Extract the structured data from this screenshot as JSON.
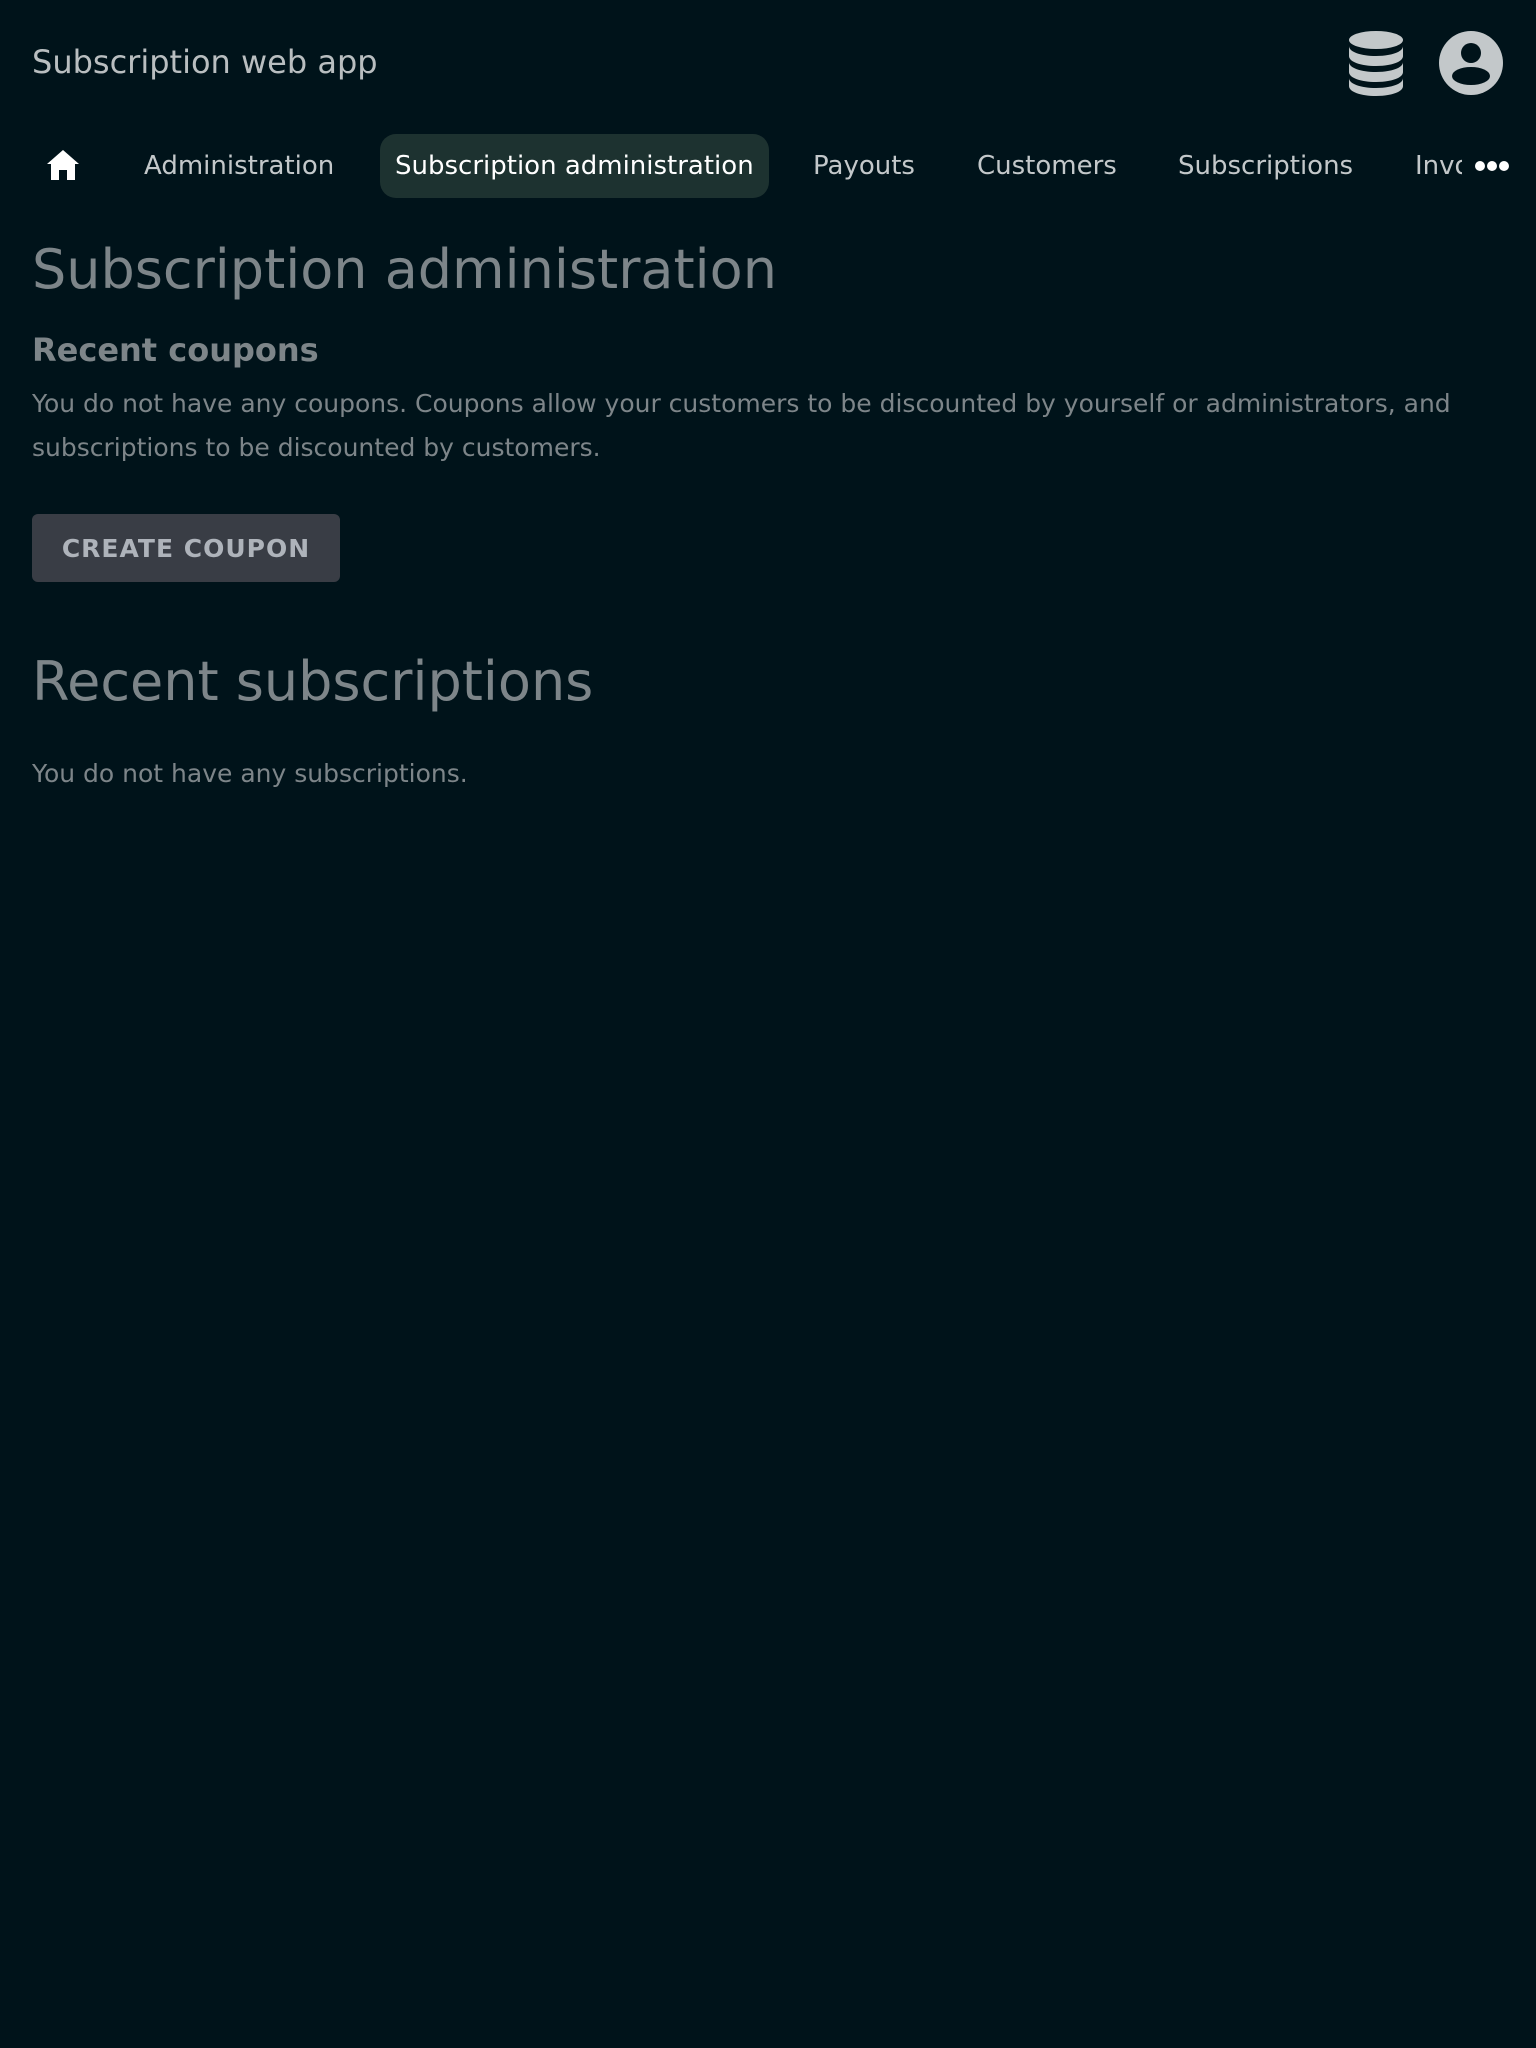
{
  "header": {
    "title": "Subscription web app",
    "icons": {
      "database": "database-icon",
      "account": "account-circle-icon"
    }
  },
  "nav": {
    "home_icon": "home-icon",
    "items": [
      {
        "label": "Administration",
        "active": false
      },
      {
        "label": "Subscription administration",
        "active": true
      },
      {
        "label": "Payouts",
        "active": false
      },
      {
        "label": "Customers",
        "active": false
      },
      {
        "label": "Subscriptions",
        "active": false
      },
      {
        "label": "Invoices",
        "active": false
      }
    ],
    "more_icon": "more-horizontal-icon"
  },
  "main": {
    "page_title": "Subscription administration",
    "coupons": {
      "heading": "Recent coupons",
      "empty_text": "You do not have any coupons. Coupons allow your customers to be discounted by yourself or administrators, and subscriptions to be discounted by customers.",
      "create_button_label": "CREATE COUPON"
    },
    "subscriptions": {
      "heading": "Recent subscriptions",
      "empty_text": "You do not have any subscriptions."
    }
  },
  "colors": {
    "background": "#00131a",
    "active_nav": "#1d3230",
    "text_muted": "#7d8589",
    "button_bg": "#393d45"
  }
}
